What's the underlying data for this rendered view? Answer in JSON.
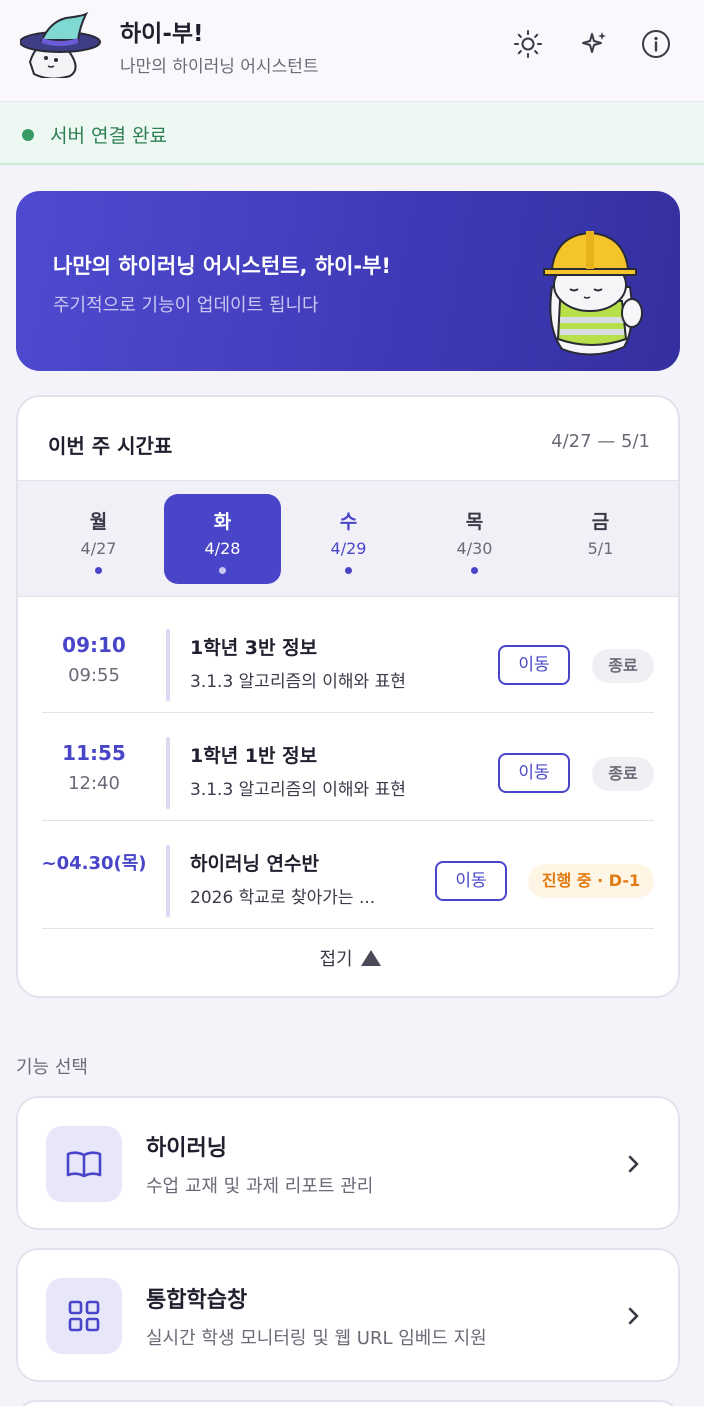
{
  "header": {
    "title": "하이-부!",
    "subtitle": "나만의 하이러닝 어시스턴트",
    "icons": [
      "sun-icon",
      "sparkles-icon",
      "info-icon"
    ]
  },
  "status": {
    "text": "서버 연결 완료",
    "color": "#3a9a66"
  },
  "banner": {
    "title": "나만의 하이러닝 어시스턴트, 하이-부!",
    "subtitle": "주기적으로 기능이 업데이트 됩니다"
  },
  "timetable": {
    "title": "이번 주 시간표",
    "range": "4/27 — 5/1",
    "days": [
      {
        "name": "월",
        "date": "4/27",
        "dot": true
      },
      {
        "name": "화",
        "date": "4/28",
        "dot": true,
        "selected": true
      },
      {
        "name": "수",
        "date": "4/29",
        "dot": true
      },
      {
        "name": "목",
        "date": "4/30",
        "dot": true
      },
      {
        "name": "금",
        "date": "5/1",
        "dot": false
      }
    ],
    "classes": [
      {
        "start": "09:10",
        "end": "09:55",
        "title": "1학년 3반 정보",
        "sub": "3.1.3 알고리즘의 이해와 표현",
        "move": "이동",
        "status": "종료"
      },
      {
        "start": "11:55",
        "end": "12:40",
        "title": "1학년 1반 정보",
        "sub": "3.1.3 알고리즘의 이해와 표현",
        "move": "이동",
        "status": "종료"
      },
      {
        "range": "~04.30(목)",
        "title": "하이러닝 연수반",
        "sub": "2026 학교로 찾아가는 ...",
        "move": "이동",
        "status": "진행 중 · D-1"
      }
    ],
    "collapse": "접기"
  },
  "features": {
    "section_label": "기능 선택",
    "items": [
      {
        "title": "하이러닝",
        "sub": "수업 교재 및 과제 리포트 관리",
        "icon": "book-icon"
      },
      {
        "title": "통합학습창",
        "sub": "실시간 학생 모니터링 및 웹 URL 임베드 지원",
        "icon": "grid-icon"
      }
    ]
  },
  "colors": {
    "accent": "#4945c9",
    "banner": "#3f3bb8",
    "warn": "#e07a12"
  }
}
